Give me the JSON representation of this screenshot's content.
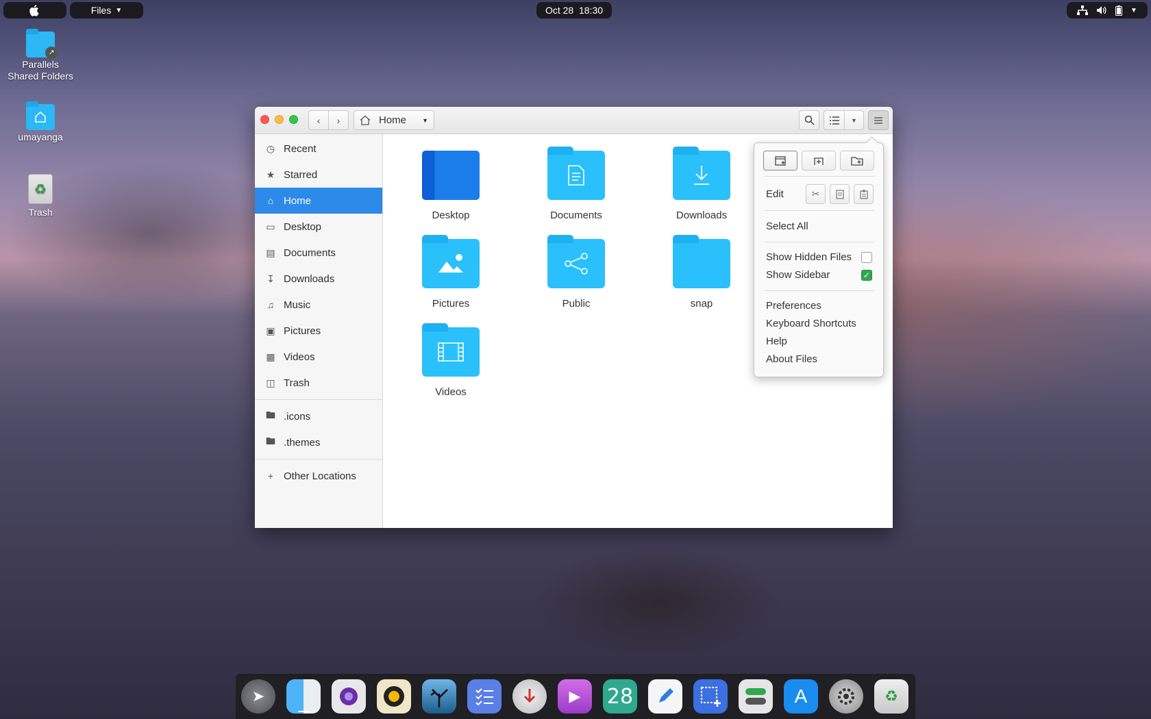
{
  "topbar": {
    "app_menu": "Files",
    "clock": "Oct 28  18:30"
  },
  "desktop": {
    "icons": [
      {
        "label": "Parallels\nShared Folders"
      },
      {
        "label": "umayanga"
      },
      {
        "label": "Trash"
      }
    ]
  },
  "window": {
    "path_label": "Home",
    "sidebar": {
      "items": [
        {
          "label": "Recent",
          "icon": "clock-icon"
        },
        {
          "label": "Starred",
          "icon": "star-icon"
        },
        {
          "label": "Home",
          "icon": "home-icon",
          "active": true
        },
        {
          "label": "Desktop",
          "icon": "desktop-icon"
        },
        {
          "label": "Documents",
          "icon": "document-icon"
        },
        {
          "label": "Downloads",
          "icon": "download-icon"
        },
        {
          "label": "Music",
          "icon": "music-icon"
        },
        {
          "label": "Pictures",
          "icon": "picture-icon"
        },
        {
          "label": "Videos",
          "icon": "film-icon"
        },
        {
          "label": "Trash",
          "icon": "trash-icon"
        }
      ],
      "bookmarks": [
        {
          "label": ".icons",
          "icon": "folder-icon"
        },
        {
          "label": ".themes",
          "icon": "folder-icon"
        }
      ],
      "other": {
        "label": "Other Locations",
        "icon": "plus-icon"
      }
    },
    "files": [
      {
        "label": "Desktop"
      },
      {
        "label": "Documents"
      },
      {
        "label": "Downloads"
      },
      {
        "label": "Pictures"
      },
      {
        "label": "Public"
      },
      {
        "label": "snap"
      },
      {
        "label": "Videos"
      }
    ]
  },
  "menu": {
    "edit_label": "Edit",
    "select_all": "Select All",
    "show_hidden_files": "Show Hidden Files",
    "show_hidden_checked": false,
    "show_sidebar": "Show Sidebar",
    "show_sidebar_checked": true,
    "preferences": "Preferences",
    "keyboard_shortcuts": "Keyboard Shortcuts",
    "help": "Help",
    "about": "About Files"
  },
  "dock": {
    "calendar_day": "28",
    "apps": [
      "launchpad-icon",
      "finder-icon",
      "screenshot-camera-icon",
      "rhythmbox-icon",
      "photos-icon",
      "tasks-icon",
      "installer-icon",
      "video-player-icon",
      "calendar-icon",
      "text-editor-icon",
      "screenshot-tool-icon",
      "tweaks-icon",
      "app-store-icon",
      "settings-icon",
      "trash-icon"
    ]
  },
  "colors": {
    "accent": "#2d8ae8",
    "folder": "#29c0fb"
  }
}
